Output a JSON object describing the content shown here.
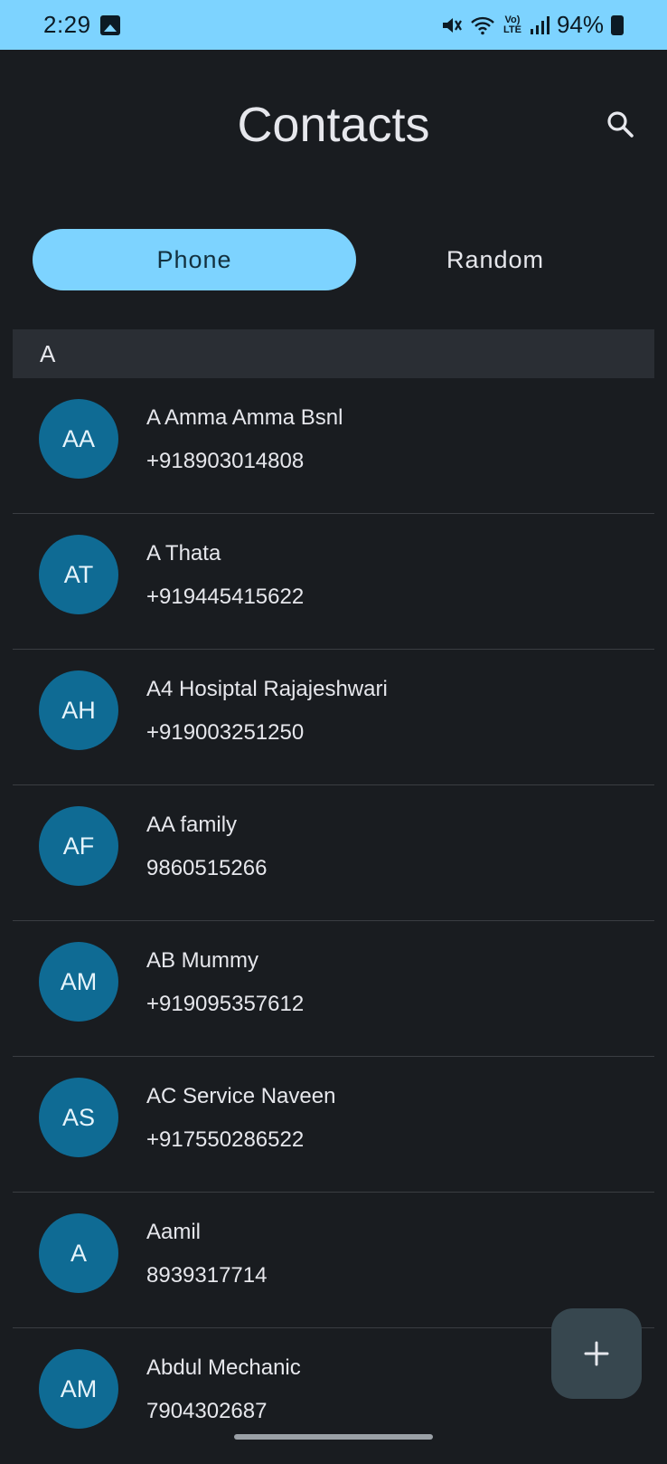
{
  "status_bar": {
    "time": "2:29",
    "battery_text": "94%",
    "network_label": "Vo) LTE"
  },
  "header": {
    "title": "Contacts"
  },
  "tabs": [
    {
      "label": "Phone",
      "active": true
    },
    {
      "label": "Random",
      "active": false
    }
  ],
  "section": {
    "letter": "A"
  },
  "contacts": [
    {
      "initials": "AA",
      "name": "A Amma Amma Bsnl",
      "phone": "+918903014808"
    },
    {
      "initials": "AT",
      "name": "A Thata",
      "phone": "+919445415622"
    },
    {
      "initials": "AH",
      "name": "A4 Hosiptal Rajajeshwari",
      "phone": "+919003251250"
    },
    {
      "initials": "AF",
      "name": "AA family",
      "phone": "9860515266"
    },
    {
      "initials": "AM",
      "name": "AB Mummy",
      "phone": "+919095357612"
    },
    {
      "initials": "AS",
      "name": "AC Service Naveen",
      "phone": "+917550286522"
    },
    {
      "initials": "A",
      "name": "Aamil",
      "phone": "8939317714"
    },
    {
      "initials": "AM",
      "name": "Abdul Mechanic",
      "phone": "7904302687"
    }
  ],
  "colors": {
    "accent": "#7dd3ff",
    "background": "#191c20",
    "avatar": "#0f6b94",
    "fab": "#37474f"
  },
  "icons": {
    "search": "search-icon",
    "add": "plus-icon"
  }
}
